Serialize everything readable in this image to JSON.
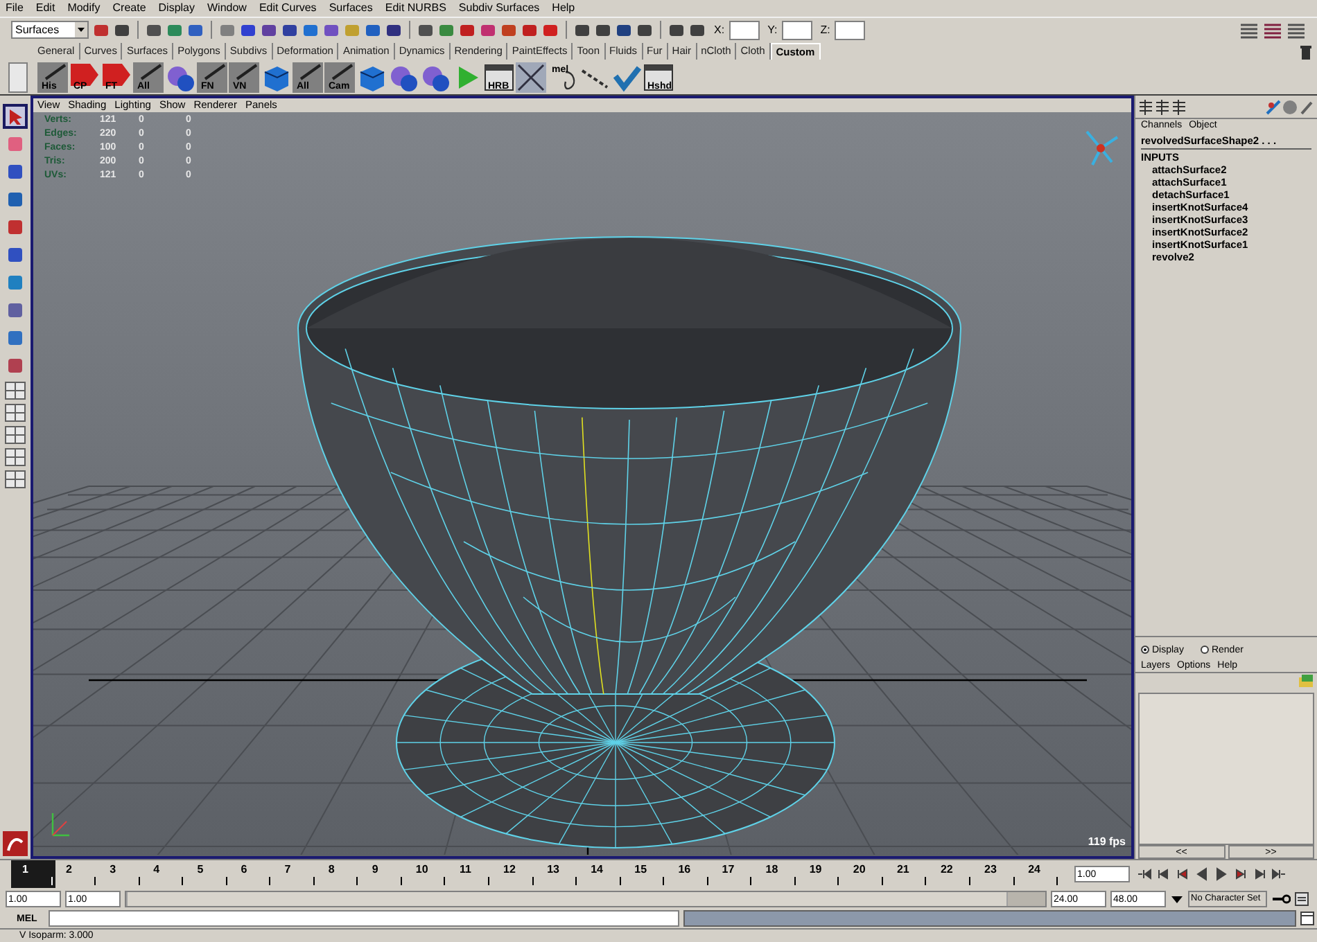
{
  "menu_bar": [
    "File",
    "Edit",
    "Modify",
    "Create",
    "Display",
    "Window",
    "Edit Curves",
    "Surfaces",
    "Edit NURBS",
    "Subdiv Surfaces",
    "Help"
  ],
  "status_line": {
    "menu_set": "Surfaces",
    "x_label": "X:",
    "y_label": "Y:",
    "z_label": "Z:"
  },
  "shelf_tabs": [
    {
      "label": "General",
      "selected": false
    },
    {
      "label": "Curves",
      "selected": false
    },
    {
      "label": "Surfaces",
      "selected": false
    },
    {
      "label": "Polygons",
      "selected": false
    },
    {
      "label": "Subdivs",
      "selected": false
    },
    {
      "label": "Deformation",
      "selected": false
    },
    {
      "label": "Animation",
      "selected": false
    },
    {
      "label": "Dynamics",
      "selected": false
    },
    {
      "label": "Rendering",
      "selected": false
    },
    {
      "label": "PaintEffects",
      "selected": false
    },
    {
      "label": "Toon",
      "selected": false
    },
    {
      "label": "Fluids",
      "selected": false
    },
    {
      "label": "Fur",
      "selected": false
    },
    {
      "label": "Hair",
      "selected": false
    },
    {
      "label": "nCloth",
      "selected": false
    },
    {
      "label": "Cloth",
      "selected": false
    },
    {
      "label": "Custom",
      "selected": true
    }
  ],
  "shelf_buttons": [
    {
      "kind": "slash",
      "label": "His"
    },
    {
      "kind": "arrow",
      "label": "CP"
    },
    {
      "kind": "arrow",
      "label": "FT"
    },
    {
      "kind": "slash",
      "label": "All"
    },
    {
      "kind": "sphere"
    },
    {
      "kind": "slash",
      "label": "FN"
    },
    {
      "kind": "slash",
      "label": "VN"
    },
    {
      "kind": "cube"
    },
    {
      "kind": "slash",
      "label": "All"
    },
    {
      "kind": "slash",
      "label": "Cam"
    },
    {
      "kind": "cube"
    },
    {
      "kind": "sphere"
    },
    {
      "kind": "sphere"
    },
    {
      "kind": "play"
    },
    {
      "kind": "window",
      "label": "HRB"
    },
    {
      "kind": "cross"
    },
    {
      "kind": "mel",
      "label": "mel"
    },
    {
      "kind": "chain"
    },
    {
      "kind": "check"
    },
    {
      "kind": "window",
      "label": "Hshd"
    }
  ],
  "toolbox": [
    {
      "selected": true
    },
    {
      "selected": false
    },
    {
      "selected": false
    },
    {
      "selected": false
    },
    {
      "selected": false
    },
    {
      "selected": false
    },
    {
      "selected": false
    },
    {
      "selected": false
    },
    {
      "selected": false
    },
    {
      "selected": false
    }
  ],
  "viewport": {
    "menu": [
      "View",
      "Shading",
      "Lighting",
      "Show",
      "Renderer",
      "Panels"
    ],
    "hud": [
      {
        "label": "Verts:",
        "values": [
          "121",
          "0",
          "0"
        ]
      },
      {
        "label": "Edges:",
        "values": [
          "220",
          "0",
          "0"
        ]
      },
      {
        "label": "Faces:",
        "values": [
          "100",
          "0",
          "0"
        ]
      },
      {
        "label": "Tris:",
        "values": [
          "200",
          "0",
          "0"
        ]
      },
      {
        "label": "UVs:",
        "values": [
          "121",
          "0",
          "0"
        ]
      }
    ],
    "fps": "119 fps"
  },
  "channel_box": {
    "menu": [
      "Channels",
      "Object"
    ],
    "node": "revolvedSurfaceShape2 . . .",
    "inputs_heading": "INPUTS",
    "inputs": [
      "attachSurface2",
      "attachSurface1",
      "detachSurface1",
      "insertKnotSurface4",
      "insertKnotSurface3",
      "insertKnotSurface2",
      "insertKnotSurface1",
      "revolve2"
    ]
  },
  "layer_editor": {
    "modes": [
      {
        "label": "Display",
        "selected": true
      },
      {
        "label": "Render",
        "selected": false
      }
    ],
    "menu": [
      "Layers",
      "Options",
      "Help"
    ]
  },
  "panel_arrows": [
    "<<",
    ">>"
  ],
  "timeline": {
    "frames": [
      {
        "label": "1",
        "selected": true
      },
      {
        "label": "2",
        "selected": false
      },
      {
        "label": "3",
        "selected": false
      },
      {
        "label": "4",
        "selected": false
      },
      {
        "label": "5",
        "selected": false
      },
      {
        "label": "6",
        "selected": false
      },
      {
        "label": "7",
        "selected": false
      },
      {
        "label": "8",
        "selected": false
      },
      {
        "label": "9",
        "selected": false
      },
      {
        "label": "10",
        "selected": false
      },
      {
        "label": "11",
        "selected": false
      },
      {
        "label": "12",
        "selected": false
      },
      {
        "label": "13",
        "selected": false
      },
      {
        "label": "14",
        "selected": false
      },
      {
        "label": "15",
        "selected": false
      },
      {
        "label": "16",
        "selected": false
      },
      {
        "label": "17",
        "selected": false
      },
      {
        "label": "18",
        "selected": false
      },
      {
        "label": "19",
        "selected": false
      },
      {
        "label": "20",
        "selected": false
      },
      {
        "label": "21",
        "selected": false
      },
      {
        "label": "22",
        "selected": false
      },
      {
        "label": "23",
        "selected": false
      },
      {
        "label": "24",
        "selected": false
      }
    ],
    "current_time": "1.00"
  },
  "range": {
    "start": "1.00",
    "playback_start": "1.00",
    "playback_end": "24.00",
    "end": "48.00",
    "level": 0.96,
    "character_set": "No Character Set"
  },
  "command_line": {
    "label": "MEL"
  },
  "help_line": "V Isoparm: 3.000"
}
